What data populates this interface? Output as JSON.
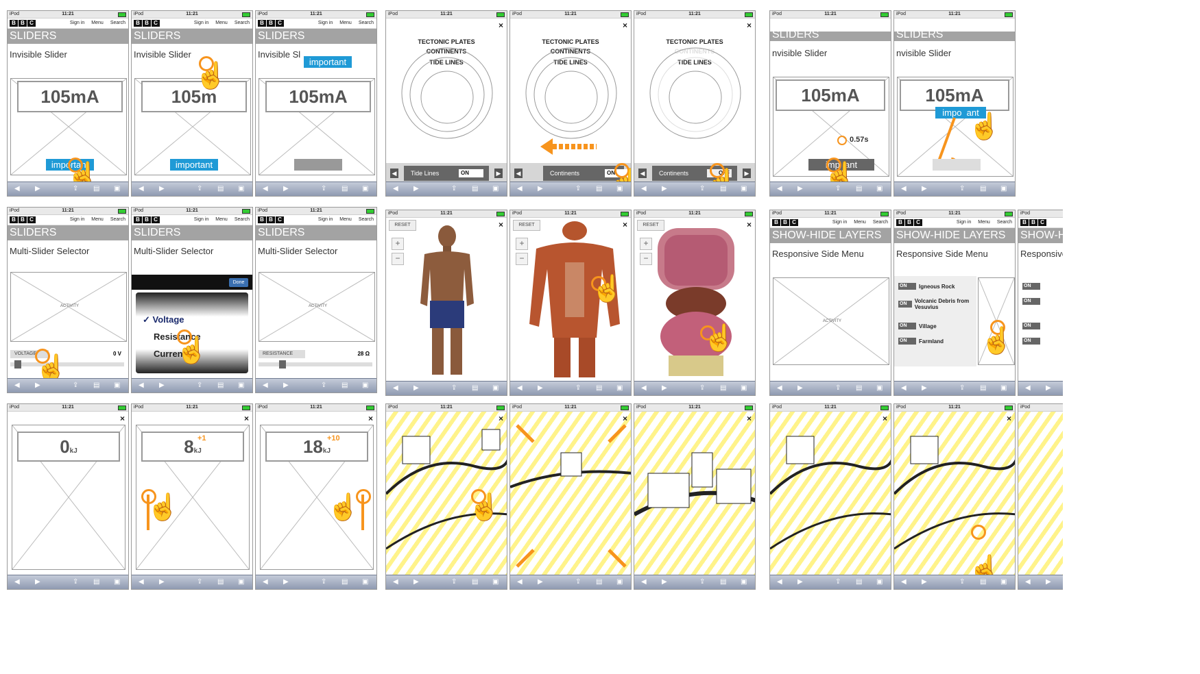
{
  "status": {
    "carrier": "iPod",
    "time": "11:21"
  },
  "bbc": {
    "logo": [
      "B",
      "B",
      "C"
    ],
    "sign_in": "Sign in",
    "menu": "Menu",
    "search": "Search"
  },
  "headers": {
    "sliders": "SLIDERS",
    "show_hide": "SHOW-HIDE LAYERS",
    "show_hide_cut": "SHOW-HID"
  },
  "subs": {
    "invisible": "Invisible Slider",
    "invisible_cut": "Invisible Sl",
    "invisible_cut2": "nvisible Slider",
    "multi": "Multi-Slider Selector",
    "responsive": "Responsive Side Menu",
    "responsive_cut": "Responsive S"
  },
  "readings": {
    "ma": "105mA",
    "ma_cut": "105m",
    "kj0": "0",
    "kj8": "8",
    "kj18": "18",
    "unit": "kJ",
    "plus1": "+1",
    "plus10": "+10",
    "timer": "0.57s"
  },
  "buttons": {
    "important": "important",
    "impo": "impo",
    "ant": "ant",
    "imp": "imp",
    "done": "Done"
  },
  "multi": {
    "activity": "ACTIVITY",
    "voltage": "VOLTAGE",
    "voltage_val": "0 V",
    "resistance": "RESISTANCE",
    "resistance_val": "28 Ω",
    "options": {
      "voltage": "✓ Voltage",
      "resistance": "Resistance",
      "current": "Current"
    }
  },
  "tectonic": {
    "plates": "TECTONIC PLATES",
    "continents": "CONTINENTS",
    "tide": "TIDE LINES",
    "tide_lines": "Tide Lines",
    "continents_btn": "Continents",
    "on": "ON",
    "off": "OFF"
  },
  "anatomy": {
    "reset": "RESET",
    "plus": "+",
    "minus": "−"
  },
  "layers": {
    "on": "ON",
    "items": [
      "Igneous Rock",
      "Volcanic Debris from Vesuvius",
      "Village",
      "Farmland"
    ]
  },
  "close": "×",
  "colors": {
    "accent": "#f7941d",
    "button_blue": "#1f9ad6",
    "header_grey": "#a3a3a3"
  }
}
